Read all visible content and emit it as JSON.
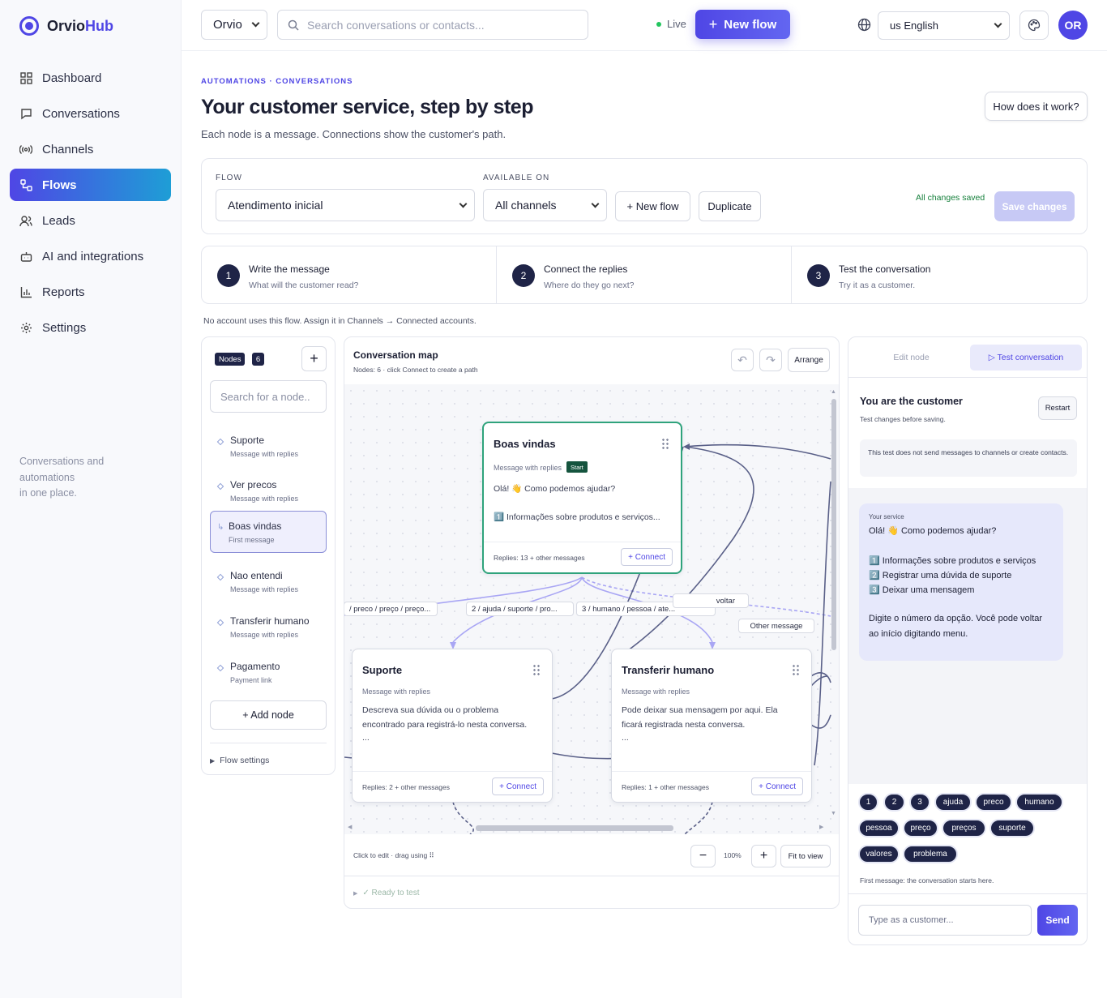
{
  "brand": {
    "name_part1": "Orvio",
    "name_part2": "Hub"
  },
  "sidebar": {
    "items": [
      {
        "label": "Dashboard",
        "icon": "grid-icon"
      },
      {
        "label": "Conversations",
        "icon": "chat-icon"
      },
      {
        "label": "Channels",
        "icon": "broadcast-icon"
      },
      {
        "label": "Flows",
        "icon": "flow-icon",
        "active": true
      },
      {
        "label": "Leads",
        "icon": "users-icon"
      },
      {
        "label": "AI and integrations",
        "icon": "bot-icon"
      },
      {
        "label": "Reports",
        "icon": "bar-chart-icon"
      },
      {
        "label": "Settings",
        "icon": "gear-icon"
      }
    ],
    "note_line1": "Conversations and",
    "note_line2": "automations",
    "note_line3": "in one place."
  },
  "topbar": {
    "workspace": "Orvio",
    "search_placeholder": "Search conversations or contacts...",
    "live_label": "Live",
    "new_flow_label": "New flow",
    "language": "us English",
    "avatar_initials": "OR"
  },
  "header": {
    "breadcrumb": "AUTOMATIONS · CONVERSATIONS",
    "title": "Your customer service, step by step",
    "subtitle": "Each node is a message. Connections show the customer's path.",
    "help_button": "How does it work?"
  },
  "flow_panel": {
    "flow_label": "FLOW",
    "flow_value": "Atendimento inicial",
    "available_label": "AVAILABLE ON",
    "available_value": "All channels",
    "new_flow_btn": "+  New flow",
    "duplicate_btn": "Duplicate",
    "saved_status": "All changes saved",
    "save_btn": "Save changes"
  },
  "steps": [
    {
      "num": "1",
      "title": "Write the message",
      "desc": "What will the customer read?"
    },
    {
      "num": "2",
      "title": "Connect the replies",
      "desc": "Where do they go next?"
    },
    {
      "num": "3",
      "title": "Test the conversation",
      "desc": "Try it as a customer."
    }
  ],
  "notice": "No account uses this flow. Assign it in Channels → Connected accounts.",
  "nodes_panel": {
    "badge_label": "Nodes",
    "badge_count": "6",
    "search_placeholder": "Search for a node..",
    "items": [
      {
        "title": "Suporte",
        "sub": "Message with replies"
      },
      {
        "title": "Ver precos",
        "sub": "Message with replies"
      },
      {
        "title": "Boas vindas",
        "sub": "First message",
        "selected": true
      },
      {
        "title": "Nao entendi",
        "sub": "Message with replies"
      },
      {
        "title": "Transferir humano",
        "sub": "Message with replies"
      },
      {
        "title": "Pagamento",
        "sub": "Payment link"
      }
    ],
    "add_node": "+  Add node",
    "flow_settings": "Flow settings"
  },
  "map": {
    "title": "Conversation map",
    "subtitle": "Nodes: 6 · click Connect to create a path",
    "arrange": "Arrange",
    "footer_hint": "Click to edit · drag using ⠿",
    "zoom": "100%",
    "fit": "Fit to view",
    "ready": "✓ Ready to test",
    "edge_labels": [
      "/ preco / preço / preço...",
      "2 / ajuda / suporte / pro...",
      "3 / humano / pessoa / ate...",
      "voltar",
      "Other message"
    ],
    "nodes": {
      "welcome": {
        "title": "Boas vindas",
        "type": "Message with replies",
        "badge": "Start",
        "line1": "Olá! 👋 Como podemos ajudar?",
        "line2": "1️⃣ Informações sobre produtos e serviços...",
        "replies": "Replies: 13 + other messages",
        "connect": "+ Connect"
      },
      "suporte": {
        "title": "Suporte",
        "type": "Message with replies",
        "line1": "Descreva sua dúvida ou o problema",
        "line2": "encontrado para registrá-lo nesta conversa.",
        "line3": "...",
        "replies": "Replies: 2 + other messages",
        "connect": "+ Connect"
      },
      "humano": {
        "title": "Transferir humano",
        "type": "Message with replies",
        "line1": "Pode deixar sua mensagem por aqui. Ela",
        "line2": "ficará registrada nesta conversa.",
        "line3": "...",
        "replies": "Replies: 1 + other messages",
        "connect": "+ Connect"
      }
    }
  },
  "test_panel": {
    "tab_edit": "Edit node",
    "tab_test": "▷ Test conversation",
    "title": "You are the customer",
    "subtitle": "Test changes before saving.",
    "restart": "Restart",
    "warning": "This test does not send messages to channels or create contacts.",
    "bubble": {
      "from": "Your service",
      "greeting": "Olá! 👋 Como podemos ajudar?",
      "opt1": "1️⃣ Informações sobre produtos e serviços",
      "opt2": "2️⃣ Registrar uma dúvida de suporte",
      "opt3": "3️⃣ Deixar uma mensagem",
      "footer": "Digite o número da opção. Você pode voltar ao início digitando menu."
    },
    "quick_replies": [
      "1",
      "2",
      "3",
      "ajuda",
      "preco",
      "humano",
      "pessoa",
      "preço",
      "preços",
      "suporte",
      "valores",
      "problema"
    ],
    "first_note": "First message: the conversation starts here.",
    "input_placeholder": "Type as a customer...",
    "send": "Send"
  }
}
